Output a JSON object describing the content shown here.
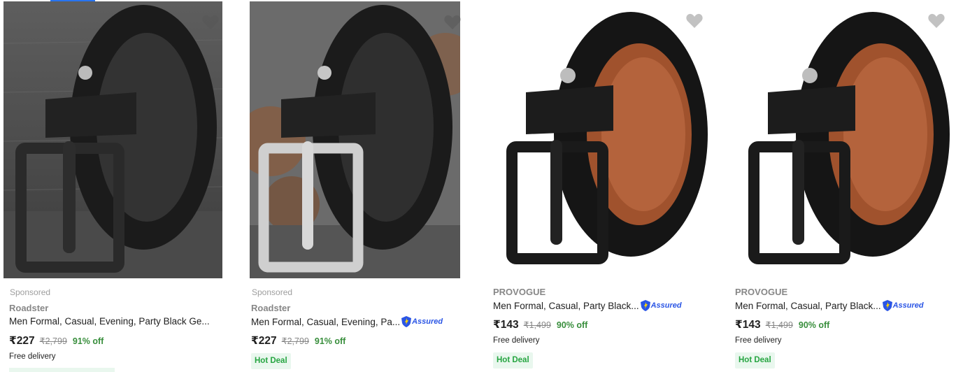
{
  "colors": {
    "accent": "#2874f0",
    "discount": "#388e3c",
    "assured": "#2a55e5",
    "hot_deal_bg": "#e9f7ee",
    "hot_deal_text": "#26a541"
  },
  "products": [
    {
      "sponsored": "Sponsored",
      "brand": "Roadster",
      "title": "Men Formal, Casual, Evening, Party Black Ge...",
      "assured": false,
      "price": "₹227",
      "mrp": "₹2,799",
      "discount": "91% off",
      "delivery": "Free delivery",
      "badge": "",
      "image_icon": "black-leather-belt-image"
    },
    {
      "sponsored": "Sponsored",
      "brand": "Roadster",
      "title": "Men Formal, Casual, Evening, Pa...",
      "assured": true,
      "assured_label": "Assured",
      "price": "₹227",
      "mrp": "₹2,799",
      "discount": "91% off",
      "delivery": "",
      "badge": "Hot Deal",
      "image_icon": "black-belt-silver-buckle-image"
    },
    {
      "sponsored": "",
      "brand": "PROVOGUE",
      "title": "Men Formal, Casual, Party Black...",
      "assured": true,
      "assured_label": "Assured",
      "price": "₹143",
      "mrp": "₹1,499",
      "discount": "90% off",
      "delivery": "Free delivery",
      "badge": "Hot Deal",
      "image_icon": "black-belt-brown-inner-image"
    },
    {
      "sponsored": "",
      "brand": "PROVOGUE",
      "title": "Men Formal, Casual, Party Black...",
      "assured": true,
      "assured_label": "Assured",
      "price": "₹143",
      "mrp": "₹1,499",
      "discount": "90% off",
      "delivery": "Free delivery",
      "badge": "Hot Deal",
      "image_icon": "black-belt-brown-inner-image"
    }
  ]
}
